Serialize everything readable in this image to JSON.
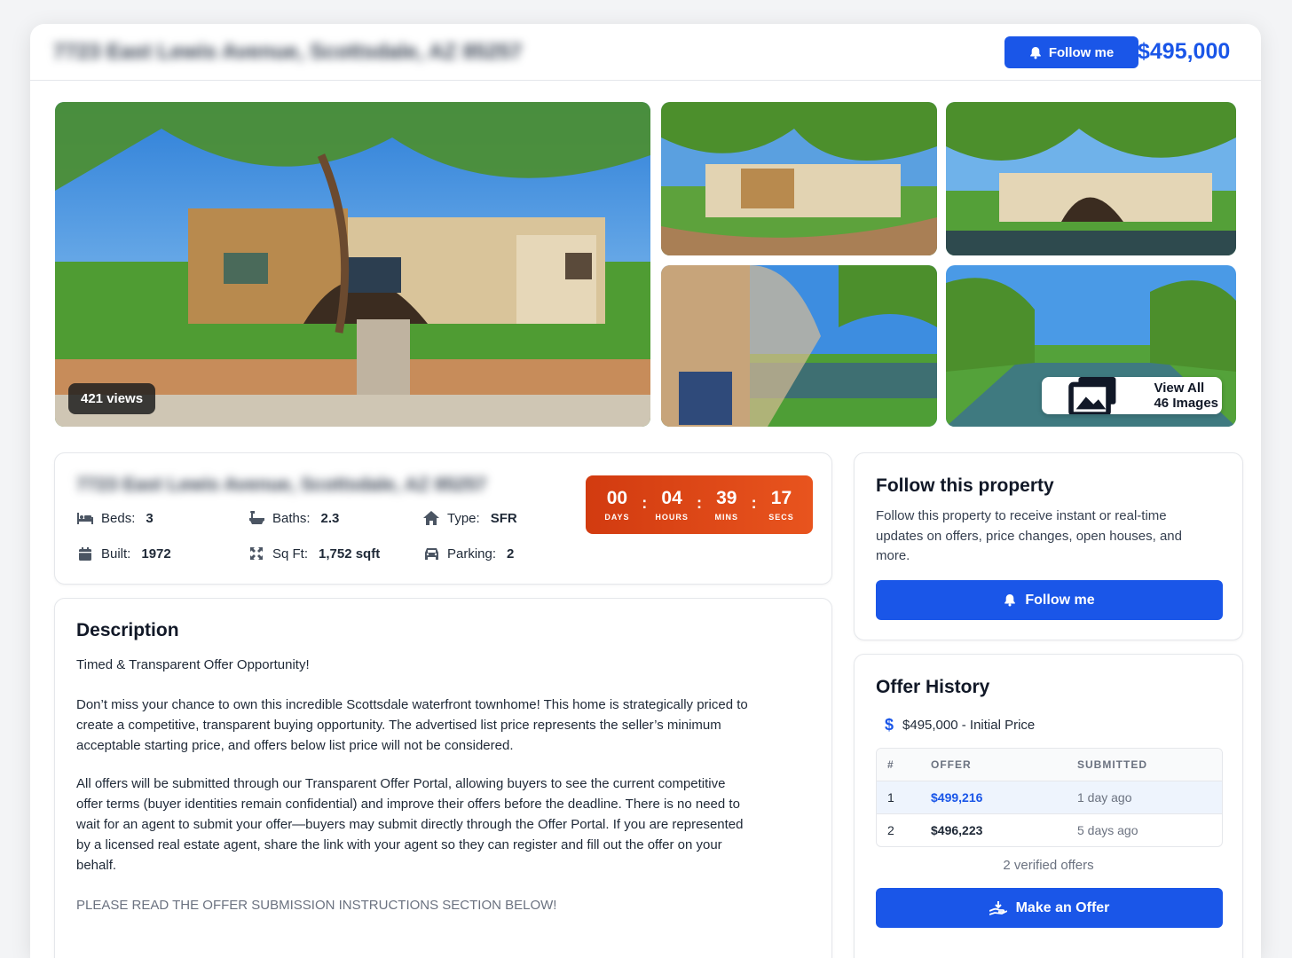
{
  "header": {
    "address": "7723 East Lewis Avenue, Scottsdale, AZ 85257",
    "follow_label": "Follow me",
    "price": "$495,000"
  },
  "gallery": {
    "views": "421 views",
    "view_all_label": "View All 46 Images"
  },
  "summary": {
    "address": "7723 East Lewis Avenue, Scottsdale, AZ 85257",
    "facts": {
      "beds": {
        "label": "Beds:",
        "value": "3",
        "icon": "bed-icon"
      },
      "baths": {
        "label": "Baths:",
        "value": "2.3",
        "icon": "bath-icon"
      },
      "type": {
        "label": "Type:",
        "value": "SFR",
        "icon": "home-icon"
      },
      "built": {
        "label": "Built:",
        "value": "1972",
        "icon": "calendar-icon"
      },
      "sqft": {
        "label": "Sq Ft:",
        "value": "1,752 sqft",
        "icon": "expand-icon"
      },
      "parking": {
        "label": "Parking:",
        "value": "2",
        "icon": "car-icon"
      }
    },
    "countdown": {
      "days": "00",
      "days_label": "DAYS",
      "hours": "04",
      "hours_label": "HOURS",
      "mins": "39",
      "mins_label": "MINS",
      "secs": "17",
      "secs_label": "SECS",
      "separator": ":",
      "color": "#e04a18"
    }
  },
  "description": {
    "heading": "Description",
    "p1": "Timed & Transparent Offer Opportunity!",
    "p2": "Don’t miss your chance to own this incredible Scottsdale waterfront townhome! This home is strategically priced to create a competitive, transparent buying opportunity. The advertised list price represents the seller’s minimum acceptable starting price, and offers below list price will not be considered.",
    "p3": "All offers will be submitted through our Transparent Offer Portal, allowing buyers to see the current competitive offer terms (buyer identities remain confidential) and improve their offers before the deadline. There is no need to wait for an agent to submit your offer—buyers may submit directly through the Offer Portal. If you are represented by a licensed real estate agent, share the link with your agent so they can register and fill out the offer on your behalf.",
    "p4": "PLEASE READ THE OFFER SUBMISSION INSTRUCTIONS SECTION BELOW!"
  },
  "follow_card": {
    "heading": "Follow this property",
    "text": "Follow this property to receive instant or real-time updates on offers, price changes, open houses, and more.",
    "button_label": "Follow me"
  },
  "offer_history": {
    "heading": "Offer History",
    "initial_dollar": "$",
    "initial_price": "$495,000 -  Initial Price",
    "columns": [
      "#",
      "OFFER",
      "SUBMITTED"
    ],
    "rows": [
      {
        "num": "1",
        "offer": "$499,216",
        "submitted": "1 day ago"
      },
      {
        "num": "2",
        "offer": "$496,223",
        "submitted": "5 days ago"
      }
    ],
    "verified": "2 verified offers",
    "button_label": "Make an Offer"
  },
  "colors": {
    "accent": "#1a56e8",
    "countdown": "#e04a18"
  }
}
